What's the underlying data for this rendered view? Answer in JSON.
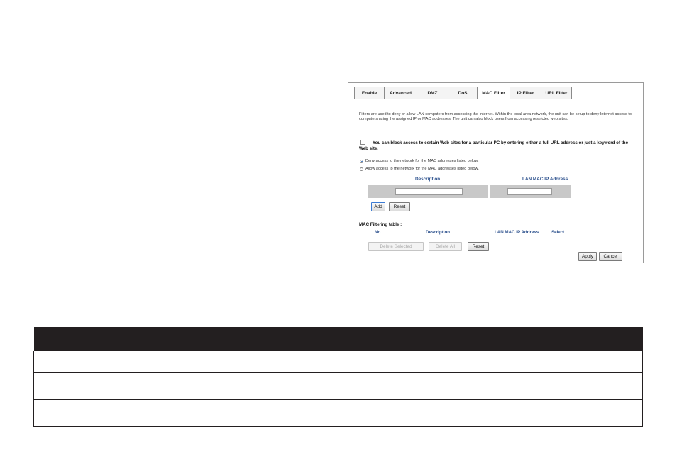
{
  "tabs": [
    {
      "label": "Enable",
      "active": false
    },
    {
      "label": "Advanced",
      "active": false
    },
    {
      "label": "DMZ",
      "active": false
    },
    {
      "label": "DoS",
      "active": false
    },
    {
      "label": "MAC Filter",
      "active": true
    },
    {
      "label": "IP Filter",
      "active": false
    },
    {
      "label": "URL Filter",
      "active": false
    }
  ],
  "intro_text": "Filters are used to deny or allow LAN computers from accessing the Internet. Within the local area network, the unit can be setup to deny Internet access to computers using the assigned IP or MAC addresses. The unit can also block users from accessing restricted web sites.",
  "block_checkbox": {
    "label": "You can block access to certain Web sites for a particular PC by entering either a full URL address or just a keyword of the Web site.",
    "checked": false
  },
  "access_mode": {
    "options": [
      {
        "label": "Deny access to the network for the MAC addresses listed below.",
        "selected": true
      },
      {
        "label": "Allow access to the network for the MAC addresses listed below.",
        "selected": false
      }
    ]
  },
  "entry": {
    "description_header": "Description",
    "mac_header": "LAN MAC IP Address.",
    "description_value": "",
    "mac_value": ""
  },
  "entry_buttons": {
    "add": "Add",
    "reset": "Reset"
  },
  "filter_table": {
    "title": "MAC Filtering table :",
    "columns": [
      "No.",
      "Description",
      "LAN MAC IP Address.",
      "Select"
    ]
  },
  "table_buttons": {
    "delete_selected": "Delete Selected",
    "delete_all": "Delete All",
    "reset": "Reset"
  },
  "footer_buttons": {
    "apply": "Apply",
    "cancel": "Cancel"
  },
  "colors": {
    "table_header": "#231f20",
    "column_header_text": "#2a4f8c",
    "entry_bar": "#c8c8c8"
  }
}
